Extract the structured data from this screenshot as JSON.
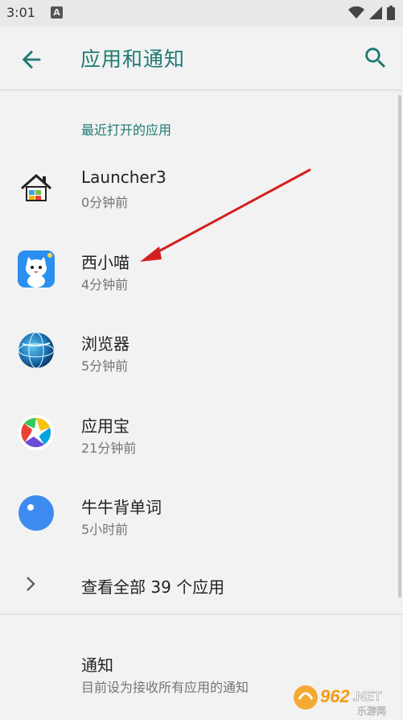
{
  "status_bar": {
    "time": "3:01",
    "notification_icon": "A"
  },
  "header": {
    "title": "应用和通知",
    "back_icon": "arrow-back-icon",
    "search_icon": "search-icon"
  },
  "recent": {
    "header": "最近打开的应用",
    "apps": [
      {
        "name": "Launcher3",
        "time": "0分钟前",
        "icon": "launcher-house-icon"
      },
      {
        "name": "西小喵",
        "time": "4分钟前",
        "icon": "cat-app-icon"
      },
      {
        "name": "浏览器",
        "time": "5分钟前",
        "icon": "browser-globe-icon"
      },
      {
        "name": "应用宝",
        "time": "21分钟前",
        "icon": "app-store-icon"
      },
      {
        "name": "牛牛背单词",
        "time": "5小时前",
        "icon": "word-app-icon"
      }
    ],
    "see_all": "查看全部 39 个应用"
  },
  "notifications": {
    "title": "通知",
    "subtitle": "目前设为接收所有应用的通知"
  },
  "watermark": {
    "brand": "962",
    "suffix": ".NET",
    "tagline": "乐游网"
  },
  "colors": {
    "accent": "#1e7a72",
    "arrow": "#d42020"
  }
}
